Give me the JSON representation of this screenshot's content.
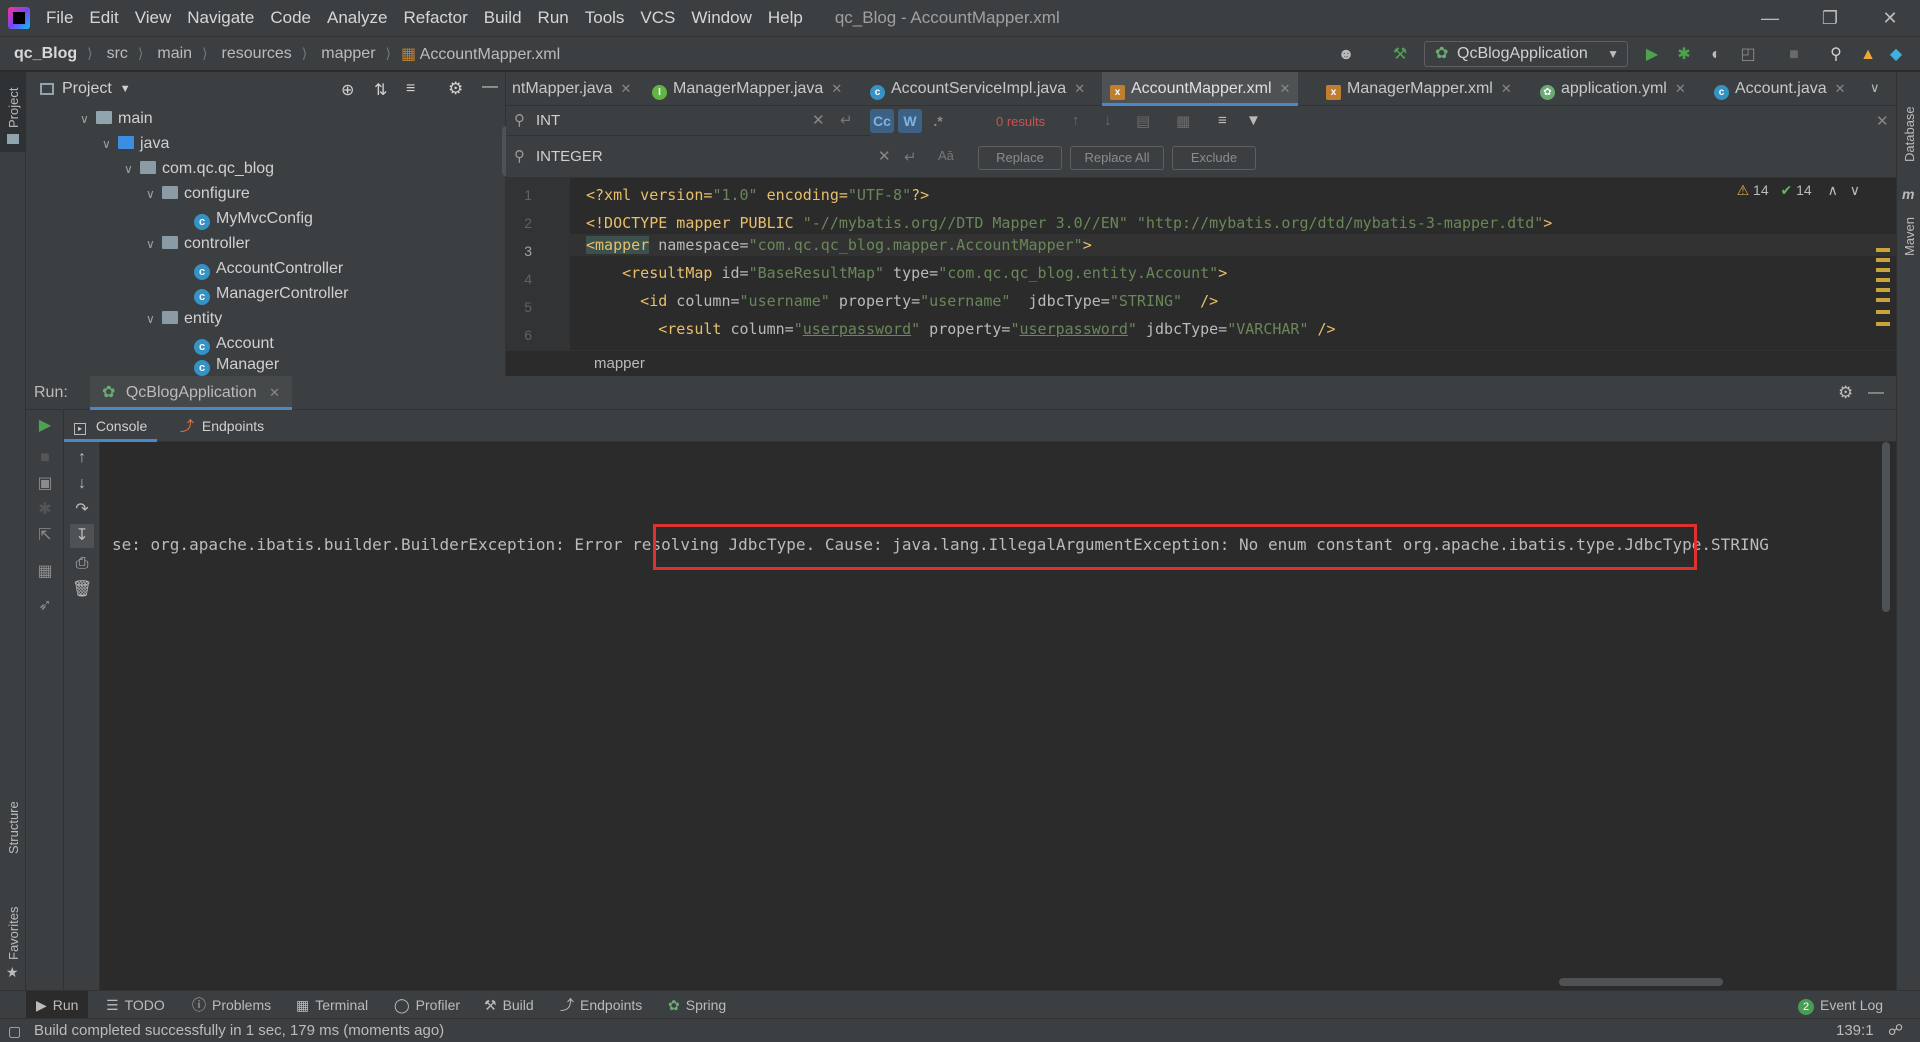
{
  "menubar": {
    "items": [
      "File",
      "Edit",
      "View",
      "Navigate",
      "Code",
      "Analyze",
      "Refactor",
      "Build",
      "Run",
      "Tools",
      "VCS",
      "Window",
      "Help"
    ],
    "window_title": "qc_Blog - AccountMapper.xml"
  },
  "navbar": {
    "breadcrumbs": [
      "qc_Blog",
      "src",
      "main",
      "resources",
      "mapper",
      "AccountMapper.xml"
    ],
    "run_config": "QcBlogApplication"
  },
  "left_stripe": {
    "project": "Project",
    "structure": "Structure",
    "favorites": "Favorites"
  },
  "right_stripe": {
    "database": "Database",
    "maven": "Maven"
  },
  "project_panel": {
    "title": "Project",
    "tree": [
      {
        "label": "main",
        "kind": "folder"
      },
      {
        "label": "java",
        "kind": "folder-blue"
      },
      {
        "label": "com.qc.qc_blog",
        "kind": "package"
      },
      {
        "label": "configure",
        "kind": "package"
      },
      {
        "label": "MyMvcConfig",
        "kind": "class"
      },
      {
        "label": "controller",
        "kind": "package"
      },
      {
        "label": "AccountController",
        "kind": "class"
      },
      {
        "label": "ManagerController",
        "kind": "class"
      },
      {
        "label": "entity",
        "kind": "package"
      },
      {
        "label": "Account",
        "kind": "class"
      },
      {
        "label": "Manager",
        "kind": "class"
      }
    ]
  },
  "editor": {
    "tabs": [
      {
        "label": "ntMapper.java",
        "icon": "interface-icon"
      },
      {
        "label": "ManagerMapper.java",
        "icon": "interface-icon"
      },
      {
        "label": "AccountServiceImpl.java",
        "icon": "class-icon"
      },
      {
        "label": "AccountMapper.xml",
        "icon": "xml-icon"
      },
      {
        "label": "ManagerMapper.xml",
        "icon": "xml-icon"
      },
      {
        "label": "application.yml",
        "icon": "spring-icon"
      },
      {
        "label": "Account.java",
        "icon": "class-icon"
      }
    ],
    "find": {
      "search": "INT",
      "replace": "INTEGER",
      "results": "0 results",
      "opt_case": "Cc",
      "opt_words": "W",
      "opt_regex": ".*",
      "replace_btn": "Replace",
      "replace_all_btn": "Replace All",
      "exclude_btn": "Exclude"
    },
    "inspections": {
      "warnings": "14",
      "ok": "14"
    },
    "lines": [
      "1",
      "2",
      "3",
      "4",
      "5",
      "6"
    ],
    "code": {
      "l1": {
        "a": "<?xml version=",
        "b": "\"1.0\"",
        "c": " encoding=",
        "d": "\"UTF-8\"",
        "e": "?>"
      },
      "l2": {
        "a": "<!DOCTYPE mapper PUBLIC ",
        "b": "\"-//mybatis.org//DTD Mapper 3.0//EN\"",
        "c": " ",
        "d": "\"http://mybatis.org/dtd/mybatis-3-mapper.dtd\"",
        "e": ">"
      },
      "l3": {
        "a": "<mapper",
        "b": " namespace=",
        "c": "\"com.qc.qc_blog.mapper.AccountMapper\"",
        "d": ">"
      },
      "l4": {
        "a": "    <resultMap",
        "b": " id=",
        "c": "\"BaseResultMap\"",
        "d": " type=",
        "e": "\"com.qc.qc_blog.entity.Account\"",
        "f": ">"
      },
      "l5": {
        "a": "      <id",
        "b": " column=",
        "c": "\"username\"",
        "d": " property=",
        "e": "\"username\"",
        "f": "  jdbcType=",
        "g": "\"STRING\"",
        "h": "  />"
      },
      "l6": {
        "a": "        <result",
        "b": " column=",
        "c": "\"",
        "d": "userpassword",
        "e": "\"",
        "f": " property=",
        "g": "\"",
        "h": "userpassword",
        "i": "\"",
        "j": " jdbcType=",
        "k": "\"VARCHAR\"",
        "l": " />"
      }
    },
    "breadcrumb": "mapper"
  },
  "run": {
    "label": "Run:",
    "config_tab": "QcBlogApplication",
    "subtabs": {
      "console": "Console",
      "endpoints": "Endpoints"
    },
    "console_prefix": "se: org.apache.ibatis.builder.BuilderException: ",
    "console_error": "Error resolving JdbcType. Cause: java.lang.IllegalArgumentException: No enum constant org.apache.ibatis.type.JdbcType.STRING"
  },
  "bottom_bar": {
    "items": [
      "Run",
      "TODO",
      "Problems",
      "Terminal",
      "Profiler",
      "Build",
      "Endpoints",
      "Spring"
    ],
    "event_log": "Event Log",
    "event_count": "2"
  },
  "status": {
    "message": "Build completed successfully in 1 sec, 179 ms (moments ago)",
    "position": "139:1"
  },
  "colors": {
    "accent": "#4a88c7",
    "error_outline": "#e03131",
    "run_green": "#4ea44e"
  }
}
